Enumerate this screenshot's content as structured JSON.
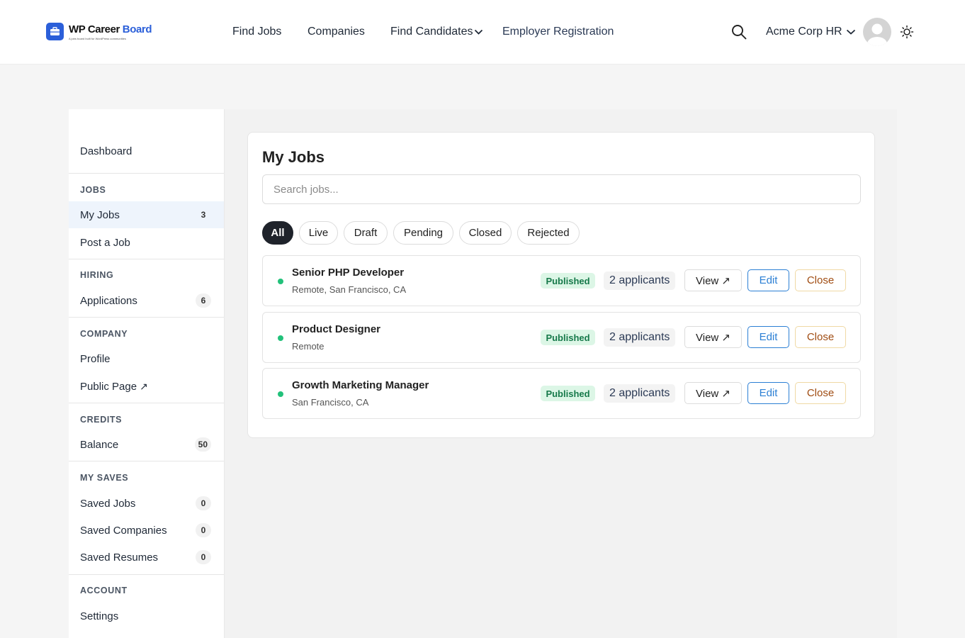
{
  "brand": {
    "name_part1": "WP Career ",
    "name_part2": "Board",
    "tagline": "A jobs board built for WordPress communities",
    "accent_color": "#2b5fd9"
  },
  "nav": {
    "find_jobs": "Find Jobs",
    "companies": "Companies",
    "find_candidates": "Find Candidates",
    "employer_registration": "Employer Registration"
  },
  "header": {
    "user_name": "Acme Corp HR",
    "search_icon": "search-icon",
    "theme_icon": "sun-icon"
  },
  "sidebar": {
    "dashboard": "Dashboard",
    "sections": {
      "jobs": "JOBS",
      "hiring": "HIRING",
      "company": "COMPANY",
      "credits": "CREDITS",
      "my_saves": "MY SAVES",
      "account": "ACCOUNT"
    },
    "items": {
      "my_jobs": {
        "label": "My Jobs",
        "count": "3"
      },
      "post_job": {
        "label": "Post a Job"
      },
      "applications": {
        "label": "Applications",
        "count": "6"
      },
      "profile": {
        "label": "Profile"
      },
      "public_page": {
        "label": "Public Page",
        "icon": "↗"
      },
      "balance": {
        "label": "Balance",
        "count": "50"
      },
      "saved_jobs": {
        "label": "Saved Jobs",
        "count": "0"
      },
      "saved_companies": {
        "label": "Saved Companies",
        "count": "0"
      },
      "saved_resumes": {
        "label": "Saved Resumes",
        "count": "0"
      },
      "settings": {
        "label": "Settings"
      }
    }
  },
  "main": {
    "title": "My Jobs",
    "search_placeholder": "Search jobs...",
    "filters": [
      "All",
      "Live",
      "Draft",
      "Pending",
      "Closed",
      "Rejected"
    ],
    "active_filter": "All",
    "jobs": [
      {
        "title": "Senior PHP Developer",
        "location": "Remote, San Francisco, CA",
        "status": "Published",
        "applicants": "2 applicants"
      },
      {
        "title": "Product Designer",
        "location": "Remote",
        "status": "Published",
        "applicants": "2 applicants"
      },
      {
        "title": "Growth Marketing Manager",
        "location": "San Francisco, CA",
        "status": "Published",
        "applicants": "2 applicants"
      }
    ],
    "actions": {
      "view": "View ↗",
      "edit": "Edit",
      "close": "Close"
    }
  }
}
